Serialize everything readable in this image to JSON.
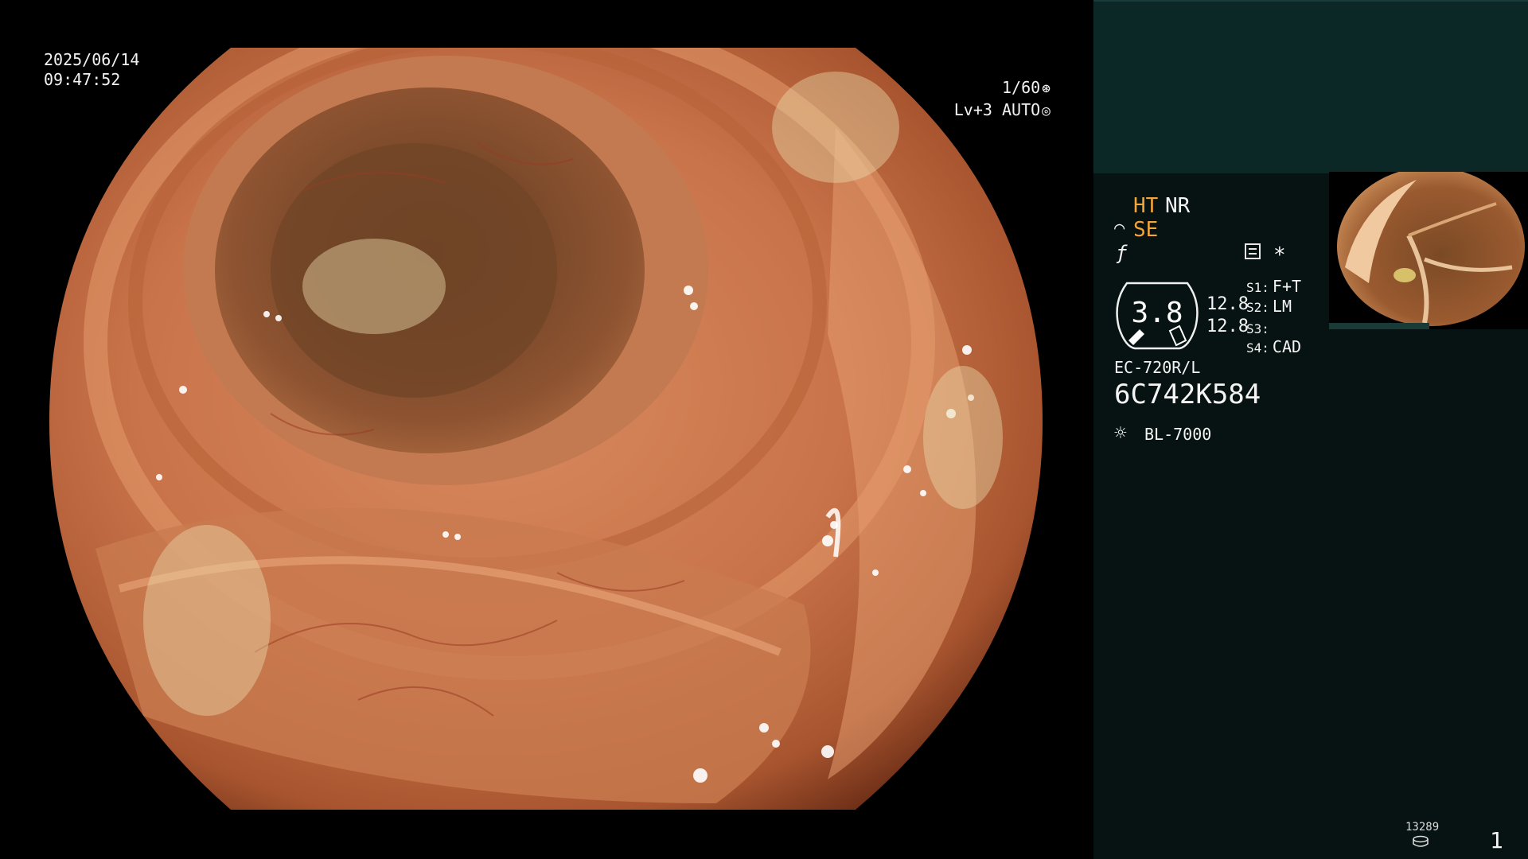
{
  "endoscope_view": {
    "date": "2025/06/14",
    "time": "09:47:52",
    "shutter": "1/60",
    "shutter_icon": "aperture-icon",
    "level": "Lv+3",
    "exposure_mode": "AUTO",
    "exposure_icon": "iris-icon"
  },
  "info_panel": {
    "ht_label": "HT",
    "nr_label": "NR",
    "se_label": "SE",
    "se_icon": "scope-icon",
    "f_icon": "f-icon",
    "menu_icon": "menu-icon",
    "asterisk": "*",
    "dial_value": "3.8",
    "dial_values": [
      "12.8",
      "12.8"
    ],
    "slots": [
      {
        "key": "S1:",
        "value": "F+T"
      },
      {
        "key": "S2:",
        "value": "LM"
      },
      {
        "key": "S3:",
        "value": ""
      },
      {
        "key": "S4:",
        "value": "CAD"
      }
    ],
    "scope_model": "EC-720R/L",
    "scope_serial": "6C742K584",
    "light_source": "BL-7000",
    "light_icon": "light-icon",
    "image_count": "13289",
    "disk_icon": "disk-icon",
    "page_number": "1"
  },
  "colors": {
    "panel_bg": "#061312",
    "panel_top_bg": "#0b2827",
    "accent_orange": "#f4a53a",
    "text": "#f4f4f4"
  }
}
